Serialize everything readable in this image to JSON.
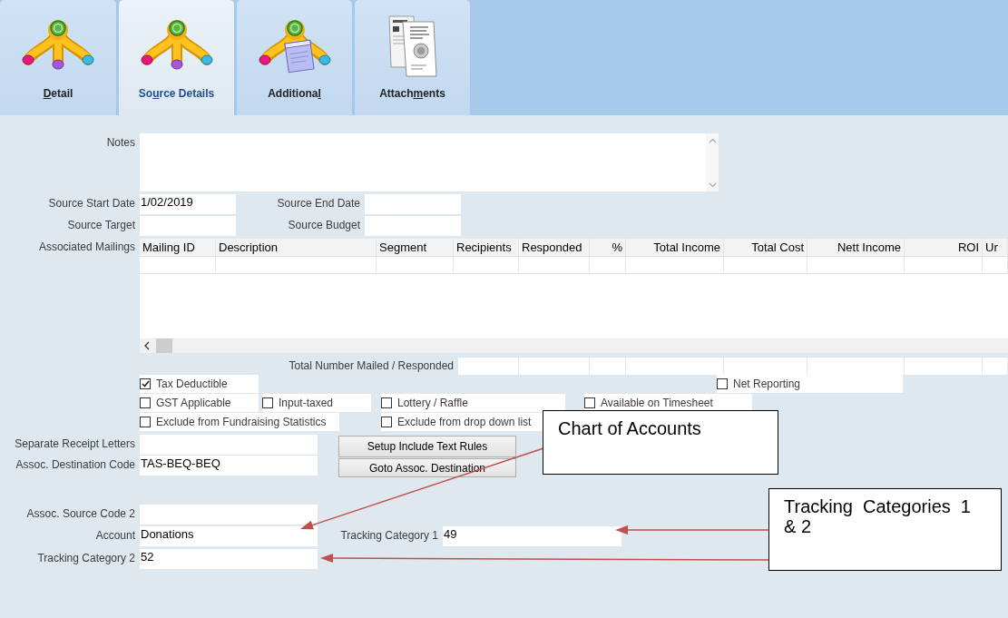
{
  "tabs": [
    {
      "kind": "dollar-branches",
      "key": "D",
      "after": "etail",
      "selected": false
    },
    {
      "kind": "dollar-branches",
      "before": "So",
      "key": "u",
      "after": "rce Details",
      "selected": true
    },
    {
      "kind": "dollar-notepad",
      "before": "Additiona",
      "key": "l",
      "selected": false
    },
    {
      "kind": "documents",
      "before": "Attach",
      "key": "m",
      "after": "ents",
      "selected": false
    }
  ],
  "notes": {
    "label": "Notes"
  },
  "source_fields": [
    [
      {
        "label": "Source Start Date",
        "value": "1/02/2019"
      },
      {
        "label": "Source End Date"
      }
    ],
    [
      {
        "label": "Source Target"
      },
      {
        "label": "Source Budget"
      }
    ]
  ],
  "associated_mailings": {
    "label": "Associated Mailings",
    "columns": [
      "Mailing ID",
      "Description",
      "Segment",
      "Recipients",
      "Responded",
      "%",
      "Total Income",
      "Total Cost",
      "Nett Income",
      "ROI",
      "Ur"
    ],
    "totals_label": "Total Number Mailed / Responded"
  },
  "checkbox_rows": [
    [
      {
        "label": "Tax Deductible",
        "checked": true
      },
      {
        "label": "Net Reporting",
        "checked": false
      }
    ],
    [
      {
        "label": "GST Applicable",
        "checked": false
      },
      {
        "label": "Input-taxed",
        "checked": false
      },
      {
        "label": "Lottery / Raffle",
        "checked": false
      },
      {
        "label": "Available on Timesheet",
        "checked": false
      }
    ],
    [
      {
        "label": "Exclude from Fundraising Statistics",
        "checked": false
      },
      {
        "label": "Exclude from drop down list",
        "checked": false
      }
    ]
  ],
  "receipt_fields": [
    {
      "label": "Separate Receipt Letters"
    },
    {
      "label": "Assoc. Destination Code",
      "value": "TAS-BEQ-BEQ"
    }
  ],
  "buttons": [
    "Setup Include Text Rules",
    "Goto Assoc. Destination"
  ],
  "account_fields": [
    [
      {
        "label": "Assoc. Source Code 2"
      }
    ],
    [
      {
        "label": "Account",
        "value": "Donations"
      },
      {
        "label": "Tracking Category 1",
        "value": "49"
      }
    ],
    [
      {
        "label": "Tracking Category 2",
        "value": "52"
      }
    ]
  ],
  "annotations": [
    {
      "text": "Chart of Accounts"
    },
    {
      "text": "Tracking Categories 1 & 2"
    }
  ]
}
